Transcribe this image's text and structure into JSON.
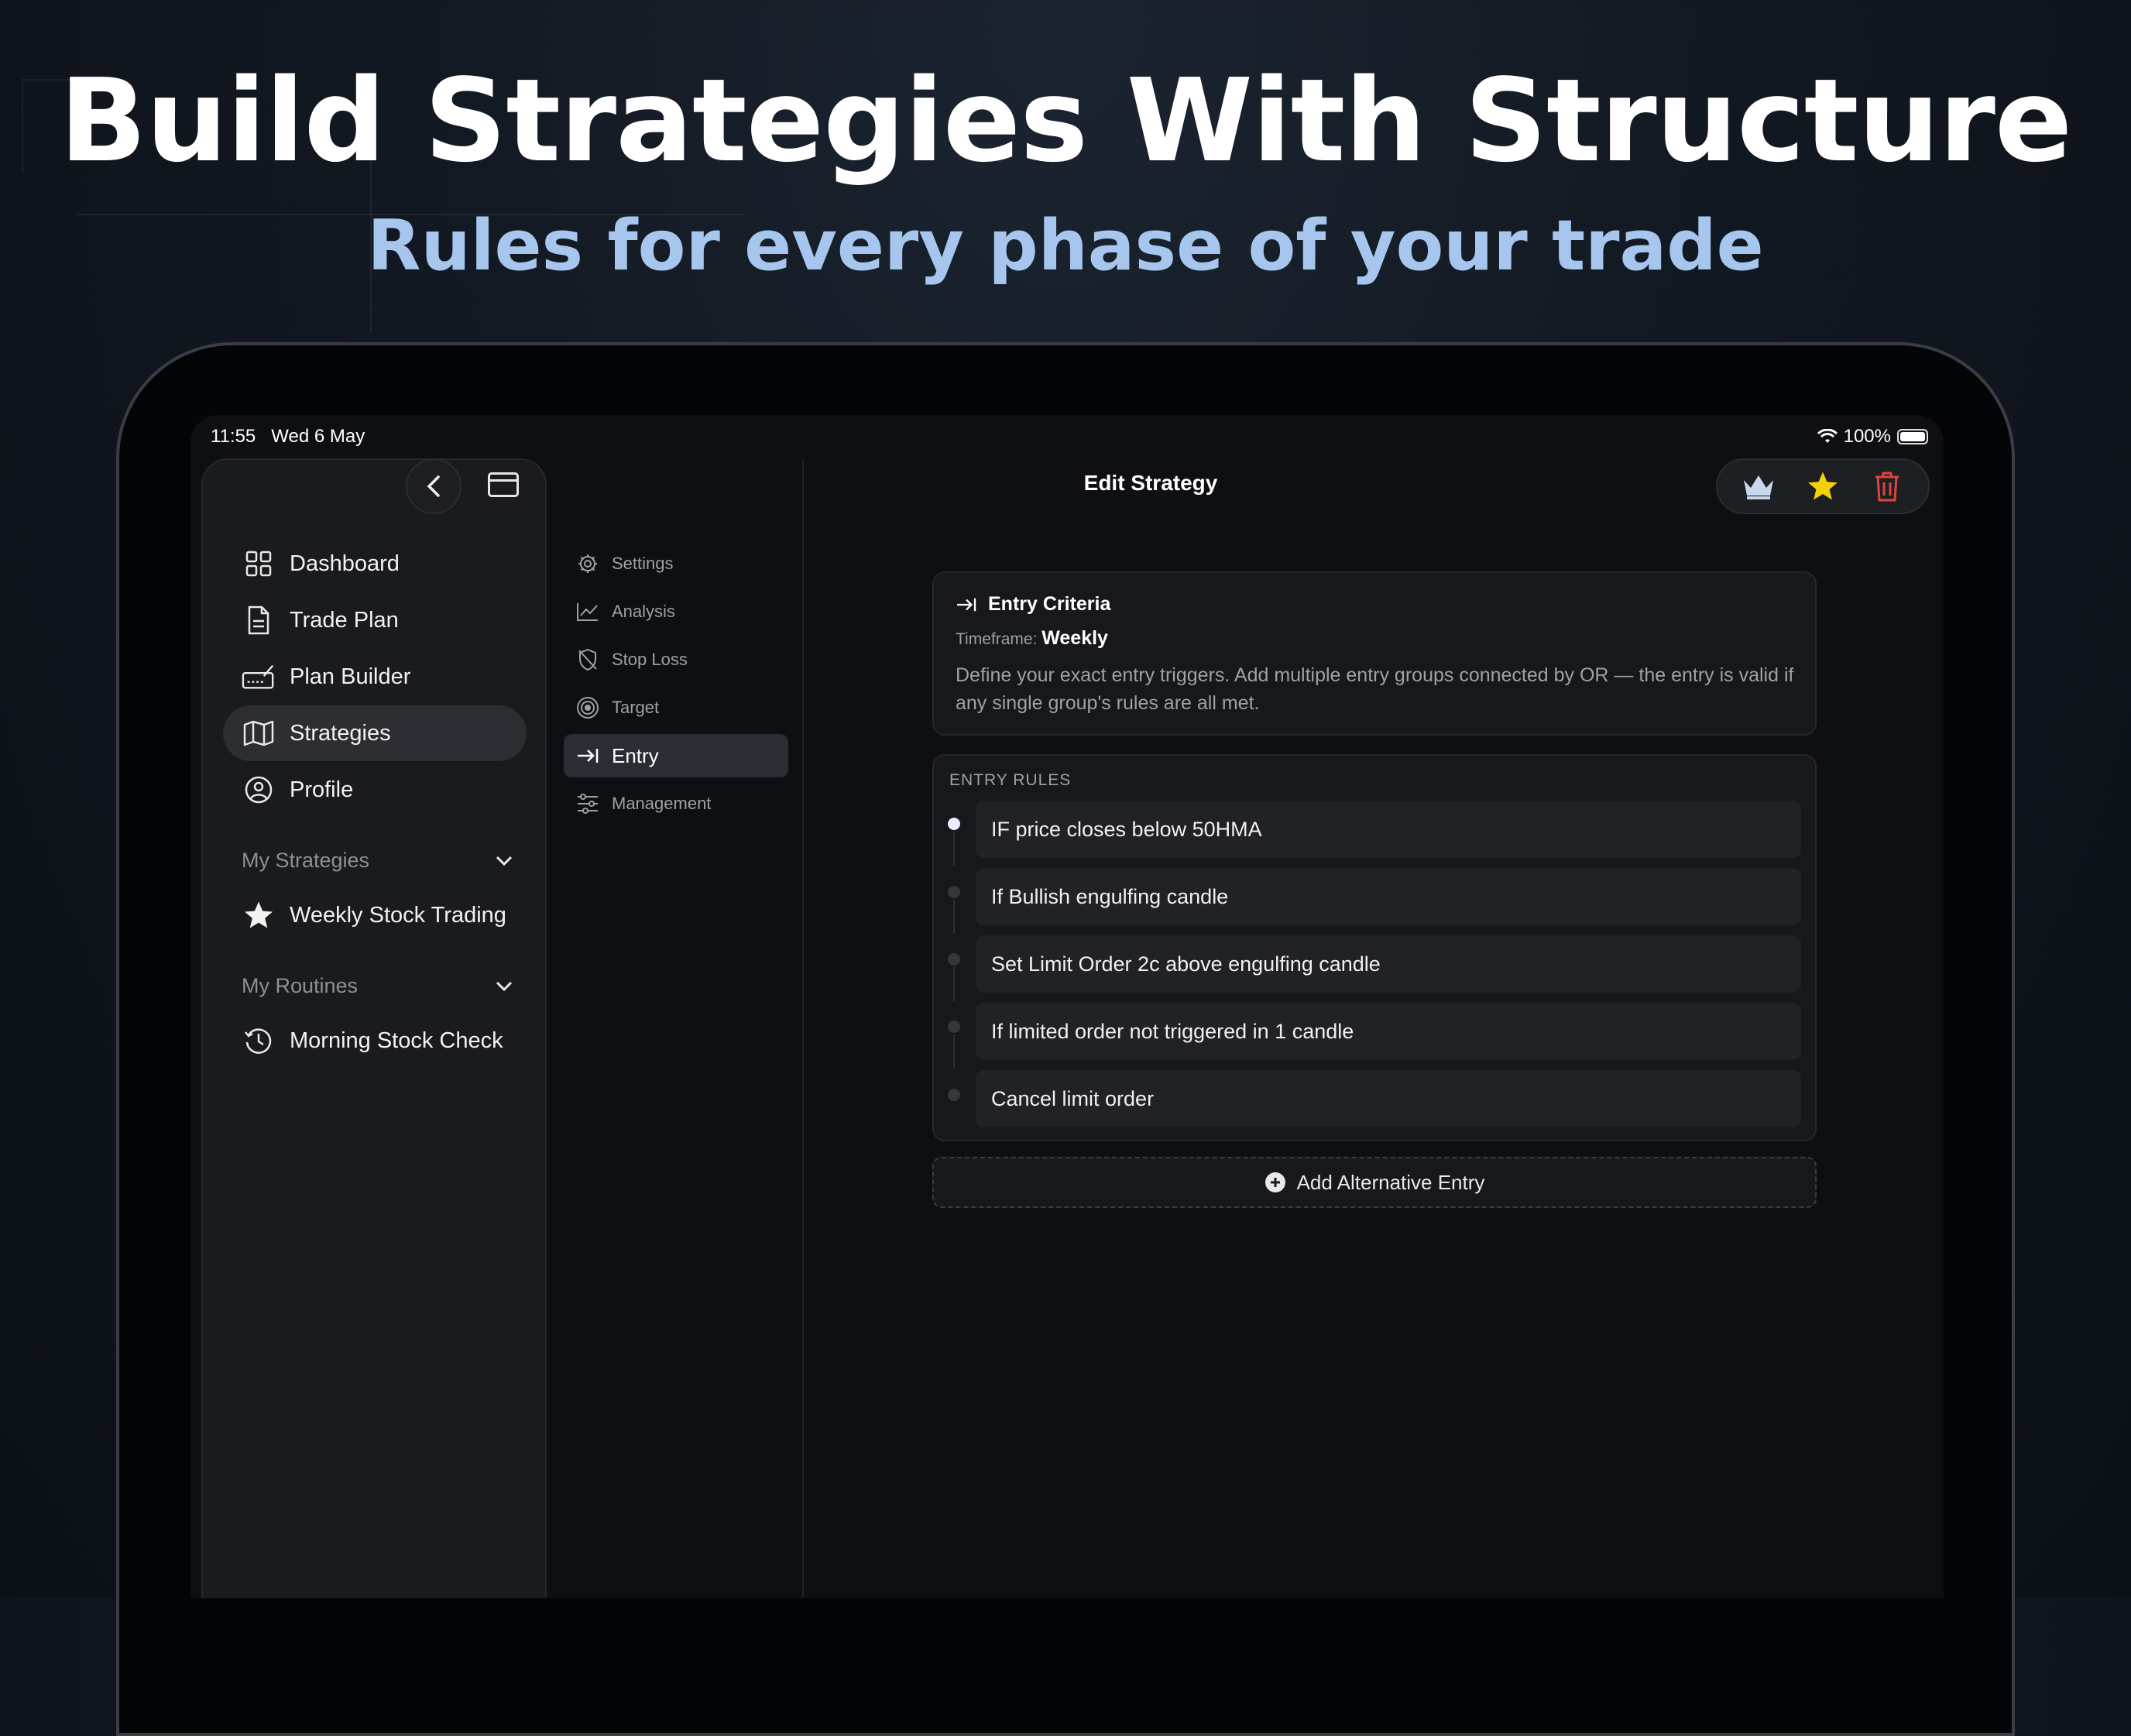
{
  "headline": "Build Strategies With Structure",
  "subheadline": "Rules for every phase of your trade",
  "status_bar": {
    "time": "11:55",
    "date": "Wed 6 May",
    "battery": "100%"
  },
  "sidebar": {
    "items": [
      {
        "label": "Dashboard",
        "icon": "grid-icon"
      },
      {
        "label": "Trade Plan",
        "icon": "document-icon"
      },
      {
        "label": "Plan Builder",
        "icon": "signature-icon"
      },
      {
        "label": "Strategies",
        "icon": "map-icon",
        "active": true
      },
      {
        "label": "Profile",
        "icon": "person-circle-icon"
      }
    ],
    "my_strategies": {
      "heading": "My Strategies",
      "items": [
        {
          "label": "Weekly Stock Trading",
          "icon": "star-icon"
        }
      ]
    },
    "my_routines": {
      "heading": "My Routines",
      "items": [
        {
          "label": "Morning Stock Check",
          "icon": "history-icon"
        }
      ]
    }
  },
  "sections": [
    {
      "label": "Settings",
      "icon": "gear-icon"
    },
    {
      "label": "Analysis",
      "icon": "chart-line-icon"
    },
    {
      "label": "Stop Loss",
      "icon": "shield-slash-icon"
    },
    {
      "label": "Target",
      "icon": "target-icon"
    },
    {
      "label": "Entry",
      "icon": "arrow-right-to-line-icon",
      "active": true
    },
    {
      "label": "Management",
      "icon": "sliders-icon"
    }
  ],
  "main": {
    "title": "Edit Strategy",
    "actions": [
      "crown-icon",
      "star-icon",
      "trash-icon"
    ],
    "criteria": {
      "title": "Entry Criteria",
      "timeframe_label": "Timeframe:",
      "timeframe_value": "Weekly",
      "description": "Define your exact entry triggers. Add multiple entry groups connected by OR — the entry is valid if any single group's rules are all met."
    },
    "rules_label": "ENTRY RULES",
    "rules": [
      "IF price closes below 50HMA",
      "If Bullish engulfing candle",
      "Set Limit Order 2c above engulfing candle",
      "If limited order not triggered in 1 candle",
      "Cancel limit order"
    ],
    "add_button": "Add Alternative Entry"
  },
  "colors": {
    "accent": "#a6c6ee",
    "star": "#f5d10a",
    "trash": "#e0443e",
    "background": "#0e0f12"
  }
}
